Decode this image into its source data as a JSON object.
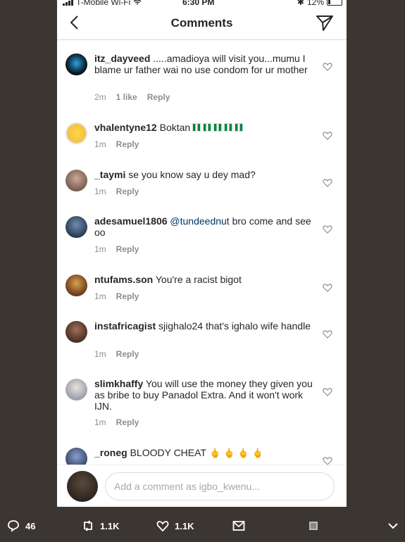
{
  "status_bar": {
    "carrier": "T-Mobile Wi-Fi",
    "time": "6:30 PM",
    "battery": "12%"
  },
  "header": {
    "title": "Comments"
  },
  "comments": [
    {
      "user": "itz_dayveed",
      "text": " .....amadioya will visit you...mumu I blame ur father wai no use condom for ur mother",
      "time": "2m",
      "likes": "1 like",
      "reply": "Reply"
    },
    {
      "user": "vhalentyne12",
      "text": " Boktan",
      "time": "1m",
      "reply": "Reply"
    },
    {
      "user": "_taymi",
      "text": " se you know say u dey mad?",
      "time": "1m",
      "reply": "Reply"
    },
    {
      "user": "adesamuel1806",
      "mention": " @tundeednut",
      "text": " bro come and see oo",
      "time": "1m",
      "reply": "Reply"
    },
    {
      "user": "ntufams.son",
      "text": " You're a racist bigot",
      "time": "1m",
      "reply": "Reply"
    },
    {
      "user": "instafricagist",
      "text": " sjighalo24 that's ighalo wife handle",
      "time": "1m",
      "reply": "Reply"
    },
    {
      "user": "slimkhaffy",
      "text": " You will use the money they given you as bribe to buy Panadol Extra. And it won't work IJN.",
      "time": "1m",
      "reply": "Reply"
    },
    {
      "user": "_roneg",
      "text": " BLOODY CHEAT",
      "time": "",
      "reply": ""
    }
  ],
  "input": {
    "placeholder": "Add a comment as igbo_kwenu..."
  },
  "tweet_actions": {
    "replies": "46",
    "retweets": "1.1K",
    "likes": "1.1K"
  },
  "colors": {
    "background": "#3b3631",
    "mention": "#003569",
    "meta": "#8e8e8e"
  }
}
